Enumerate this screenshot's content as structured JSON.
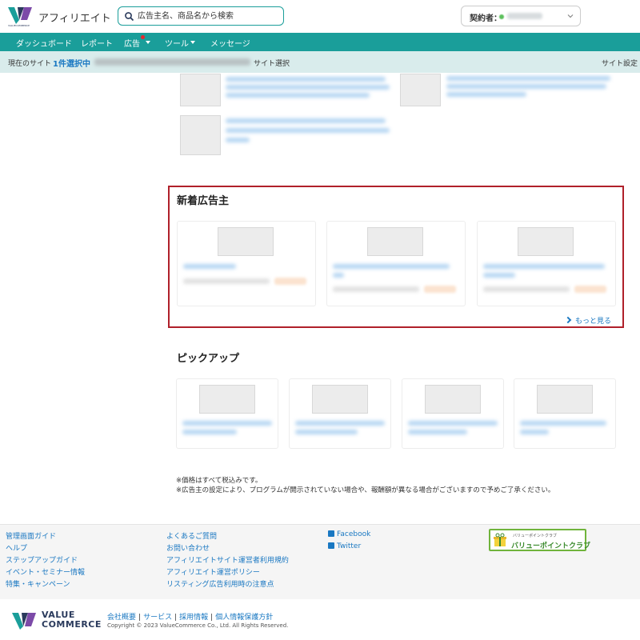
{
  "header": {
    "brand": "アフィリエイト",
    "logo_caption": "VALUECOMMERCE",
    "search_placeholder": "広告主名、商品名から検索",
    "account_label": "契約者："
  },
  "nav": {
    "items": [
      "ダッシュボード",
      "レポート",
      "広告",
      "ツール",
      "メッセージ"
    ]
  },
  "site_bar": {
    "label": "現在のサイト",
    "selected": "1件選択中",
    "select_button": "サイト選択",
    "settings": "サイト設定"
  },
  "new_advertisers": {
    "title": "新着広告主",
    "more": "もっと見る"
  },
  "pickup": {
    "title": "ピックアップ"
  },
  "notes": [
    "※価格はすべて税込みです。",
    "※広告主の設定により、プログラムが開示されていない場合や、報酬額が異なる場合がございますので予めご了承ください。"
  ],
  "footer": {
    "col1": [
      "管理画面ガイド",
      "ヘルプ",
      "ステップアップガイド",
      "イベント・セミナー情報",
      "特集・キャンペーン"
    ],
    "col2": [
      "よくあるご質問",
      "お問い合わせ",
      "アフィリエイトサイト運営者利用規約",
      "アフィリエイト運営ポリシー",
      "リスティング広告利用時の注意点"
    ],
    "social": [
      "Facebook",
      "Twitter"
    ],
    "banner_small": "バリューポイントクラブ",
    "banner_big": "バリューポイントクラブ",
    "company_logo_line1": "VALUE",
    "company_logo_line2": "COMMERCE",
    "corp_links": [
      "会社概要",
      "サービス",
      "採用情報",
      "個人情報保護方針"
    ],
    "copyright": "Copyright © 2023 ValueCommerce Co., Ltd. All Rights Reserved."
  },
  "colors": {
    "primary": "#1a9e9a",
    "link": "#1a78c2",
    "highlight_border": "#b0202a"
  }
}
